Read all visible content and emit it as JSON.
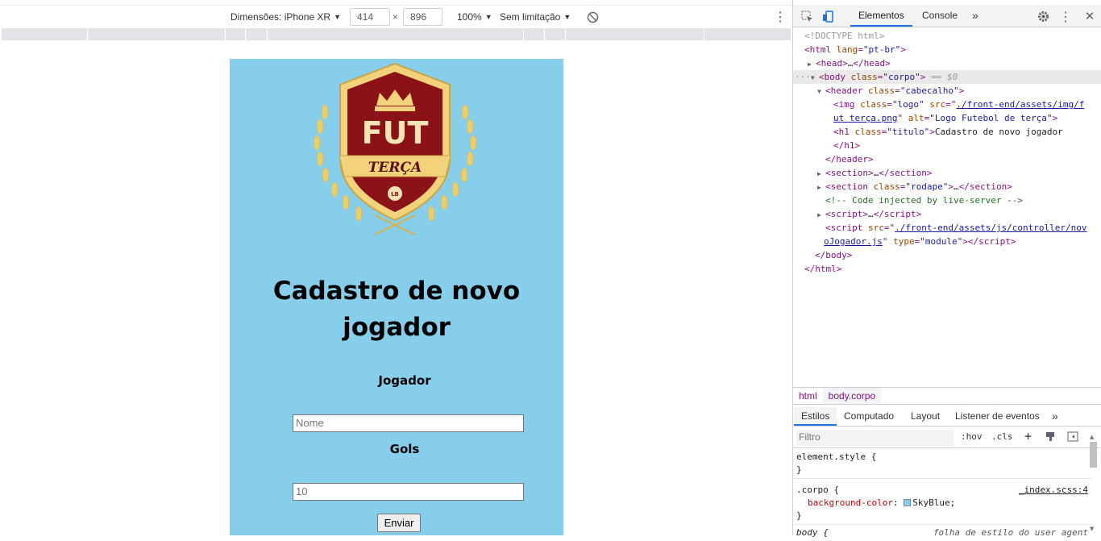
{
  "device_toolbar": {
    "dimensions_label": "Dimensões: iPhone XR",
    "width": "414",
    "times": "×",
    "height": "896",
    "zoom": "100%",
    "throttle": "Sem limitação"
  },
  "page": {
    "background": "#87CEEB",
    "title_line1": "Cadastro de novo",
    "title_line2": "jogador",
    "logo_word": "FUT",
    "logo_ribbon": "TERÇA",
    "logo_badge": "LB",
    "player_label": "Jogador",
    "name_placeholder": "Nome",
    "goals_label": "Gols",
    "goals_value": "10",
    "submit_label": "Enviar"
  },
  "devtools": {
    "tabs": [
      "Elementos",
      "Console"
    ],
    "active_tab": "Elementos",
    "more": "»",
    "dom": {
      "doctype": "<!DOCTYPE html>",
      "html_lang_val": "\"pt-br\"",
      "head_collapsed": "…",
      "body_class_val": "\"corpo\"",
      "eq_sel": "== $0",
      "header_class_val": "\"cabecalho\"",
      "img_class_val": "\"logo\"",
      "img_src_line1": "./front-end/assets/img/f",
      "img_src_line2": "ut terça.png",
      "img_alt_val": "\"Logo Futebol de terça\"",
      "h1_class_val": "\"titulo\"",
      "h1_text": "Cadastro de novo jogador",
      "section_rodape_val": "\"rodape\"",
      "comment": "<!-- Code injected by live-server -->",
      "script_src_line1": "./front-end/assets/js/controller/nov",
      "script_src_line2": "oJogador.js",
      "script_type_val": "\"module\""
    },
    "breadcrumbs": [
      "html",
      "body.corpo"
    ],
    "style_tabs": [
      "Estilos",
      "Computado",
      "Layout",
      "Listener de eventos"
    ],
    "filter_placeholder": "Filtro",
    "hov": ":hov",
    "cls": ".cls",
    "rules": {
      "element_style": "element.style {",
      "close": "}",
      "corpo_selector": ".corpo {",
      "corpo_source": "_index.scss:4",
      "corpo_prop": "background-color",
      "corpo_value": "SkyBlue;",
      "body_selector": "body {",
      "body_source": "folha de estilo do user agent"
    }
  }
}
